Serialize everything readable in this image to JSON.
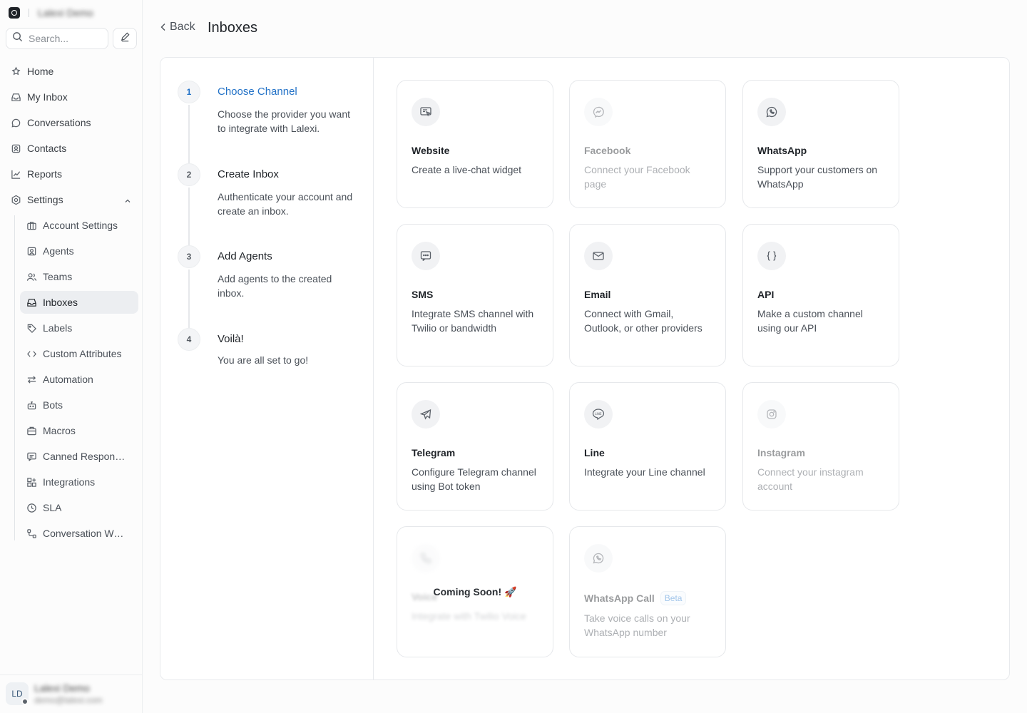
{
  "sidebar": {
    "account_name": "Lalexi Demo",
    "search_placeholder": "Search...",
    "nav": [
      {
        "label": "Home",
        "icon": "home-icon"
      },
      {
        "label": "My Inbox",
        "icon": "inbox-icon"
      },
      {
        "label": "Conversations",
        "icon": "chat-bubble-icon"
      },
      {
        "label": "Contacts",
        "icon": "contact-card-icon"
      },
      {
        "label": "Reports",
        "icon": "chart-line-icon"
      },
      {
        "label": "Settings",
        "icon": "gear-icon"
      }
    ],
    "settings_items": [
      {
        "label": "Account Settings",
        "icon": "briefcase-icon"
      },
      {
        "label": "Agents",
        "icon": "user-square-icon"
      },
      {
        "label": "Teams",
        "icon": "users-icon"
      },
      {
        "label": "Inboxes",
        "icon": "inbox-icon",
        "active": true
      },
      {
        "label": "Labels",
        "icon": "tag-icon"
      },
      {
        "label": "Custom Attributes",
        "icon": "code-icon"
      },
      {
        "label": "Automation",
        "icon": "arrows-swap-icon"
      },
      {
        "label": "Bots",
        "icon": "bot-icon"
      },
      {
        "label": "Macros",
        "icon": "toolbox-icon"
      },
      {
        "label": "Canned Responses",
        "icon": "canned-response-icon"
      },
      {
        "label": "Integrations",
        "icon": "grid-plus-icon"
      },
      {
        "label": "SLA",
        "icon": "clock-icon"
      },
      {
        "label": "Conversation Workflows",
        "icon": "workflow-icon"
      }
    ],
    "user": {
      "initials": "LD",
      "name": "Lalexi Demo",
      "email": "demo@lalexi.com"
    }
  },
  "header": {
    "back_label": "Back",
    "title": "Inboxes"
  },
  "steps": [
    {
      "num": "1",
      "title": "Choose Channel",
      "desc": "Choose the provider you want to integrate with Lalexi.",
      "active": true
    },
    {
      "num": "2",
      "title": "Create Inbox",
      "desc": "Authenticate your account and create an inbox."
    },
    {
      "num": "3",
      "title": "Add Agents",
      "desc": "Add agents to the created inbox."
    },
    {
      "num": "4",
      "title": "Voilà!",
      "desc": "You are all set to go!"
    }
  ],
  "channels": [
    {
      "title": "Website",
      "desc": "Create a live-chat widget",
      "icon": "website-widget-icon",
      "disabled": false
    },
    {
      "title": "Facebook",
      "desc": "Connect your Facebook page",
      "icon": "messenger-icon",
      "disabled": true
    },
    {
      "title": "WhatsApp",
      "desc": "Support your customers on WhatsApp",
      "icon": "whatsapp-icon",
      "disabled": false
    },
    {
      "title": "SMS",
      "desc": "Integrate SMS channel with Twilio or bandwidth",
      "icon": "sms-icon",
      "disabled": false
    },
    {
      "title": "Email",
      "desc": "Connect with Gmail, Outlook, or other providers",
      "icon": "mail-icon",
      "disabled": false
    },
    {
      "title": "API",
      "desc": "Make a custom channel using our API",
      "icon": "braces-icon",
      "disabled": false
    },
    {
      "title": "Telegram",
      "desc": "Configure Telegram channel using Bot token",
      "icon": "telegram-icon",
      "disabled": false
    },
    {
      "title": "Line",
      "desc": "Integrate your Line channel",
      "icon": "line-icon",
      "disabled": false
    },
    {
      "title": "Instagram",
      "desc": "Connect your instagram account",
      "icon": "instagram-icon",
      "disabled": true
    },
    {
      "title": "Voice",
      "desc": "Integrate with Twilio Voice",
      "icon": "phone-icon",
      "disabled": true,
      "overlay": "Coming Soon! 🚀"
    },
    {
      "title": "WhatsApp Call",
      "badge": "Beta",
      "desc": "Take voice calls on your WhatsApp number",
      "icon": "whatsapp-icon",
      "disabled": true
    }
  ]
}
